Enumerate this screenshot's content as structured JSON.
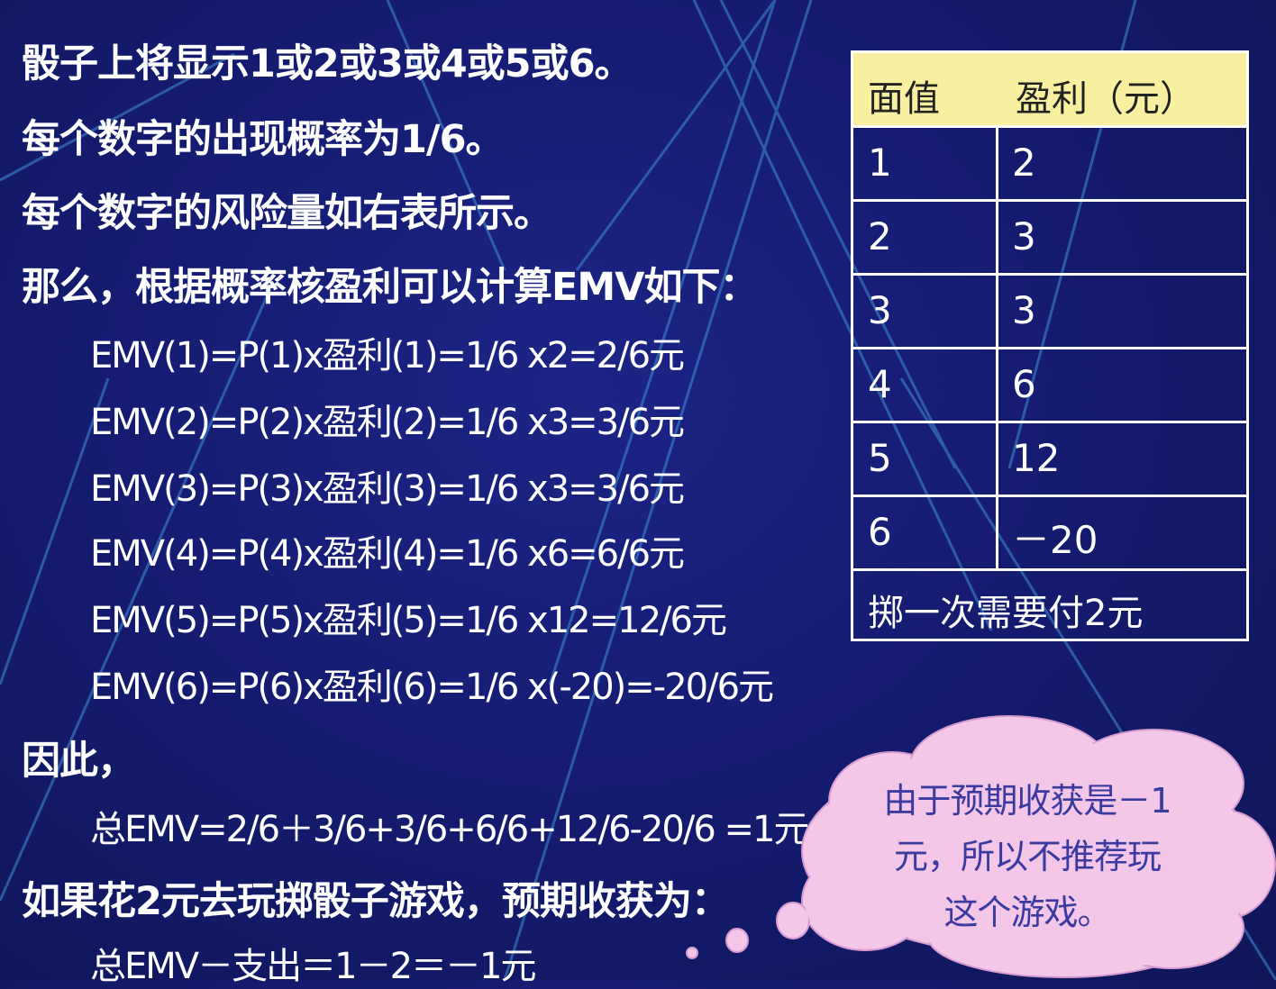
{
  "lines": {
    "l1": "骰子上将显示1或2或3或4或5或6。",
    "l2": "每个数字的出现概率为1/6。",
    "l3": "每个数字的风险量如右表所示。",
    "l4": "那么，根据概率核盈利可以计算EMV如下：",
    "emv1": "EMV(1)=P(1)x盈利(1)=1/6 x2=2/6元",
    "emv2": "EMV(2)=P(2)x盈利(2)=1/6 x3=3/6元",
    "emv3": "EMV(3)=P(3)x盈利(3)=1/6 x3=3/6元",
    "emv4": "EMV(4)=P(4)x盈利(4)=1/6 x6=6/6元",
    "emv5": "EMV(5)=P(5)x盈利(5)=1/6 x12=12/6元",
    "emv6": "EMV(6)=P(6)x盈利(6)=1/6 x(-20)=-20/6元",
    "therefore": "因此，",
    "total": "总EMV=2/6＋3/6+3/6+6/6+12/6-20/6 =1元",
    "ifplay": "如果花2元去玩掷骰子游戏，预期收获为：",
    "net": "总EMV－支出＝1－2＝－1元"
  },
  "table": {
    "header": {
      "face": "面值",
      "profit": "盈利（元）"
    },
    "rows": [
      {
        "face": "1",
        "profit": "2"
      },
      {
        "face": "2",
        "profit": "3"
      },
      {
        "face": "3",
        "profit": "3"
      },
      {
        "face": "4",
        "profit": "6"
      },
      {
        "face": "5",
        "profit": "12"
      },
      {
        "face": "6",
        "profit": "－20"
      }
    ],
    "footer": "掷一次需要付2元"
  },
  "callout": {
    "line1": "由于预期收获是－1",
    "line2": "元，所以不推荐玩",
    "line3": "这个游戏。"
  },
  "colors": {
    "background": "#151c72",
    "header_fill": "#f8f0a0",
    "cloud_fill": "#f4c6e8",
    "cloud_text": "#3a3aa0"
  }
}
